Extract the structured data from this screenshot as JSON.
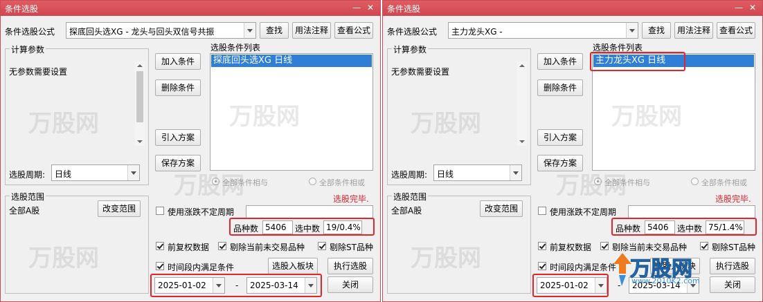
{
  "windows": [
    {
      "title": "条件选股",
      "formula_label": "条件选股公式",
      "formula_value": "探底回头选XG  -  龙头与回头双信号共振",
      "find_btn": "查找",
      "usage_btn": "用法注释",
      "view_btn": "查看公式",
      "params_group": "计算参数",
      "params_text": "无参数需要设置",
      "period_label": "选股周期:",
      "period_value": "日线",
      "cond_list_label": "选股条件列表",
      "cond_item": "探底回头选XG  日线",
      "add_btn": "加入条件",
      "del_btn": "删除条件",
      "import_btn": "引入方案",
      "save_btn": "保存方案",
      "radio_and": "全部条件相与",
      "radio_or": "全部条件相或",
      "status": "选股完毕.",
      "range_group": "选股范围",
      "range_value": "全部A股",
      "change_range_btn": "改变范围",
      "use_period_label": "使用涨跌不定周期",
      "count_label": "品种数",
      "count_value": "5406",
      "selected_label": "选中数",
      "selected_value": "19/0.4%",
      "prefix_label": "前复权数据",
      "exclude_untraded_label": "剔除当前未交易品种",
      "exclude_st_label": "剔除ST品种",
      "time_range_label": "时间段内满足条件",
      "to_block_btn": "选股入板块",
      "exec_btn": "执行选股",
      "date_from": "2025-01-02",
      "date_dash": "-",
      "date_to": "2025-03-14",
      "close_btn": "关闭"
    },
    {
      "title": "条件选股",
      "formula_label": "条件选股公式",
      "formula_value": "主力龙头XG  -",
      "find_btn": "查找",
      "usage_btn": "用法注释",
      "view_btn": "查看公式",
      "params_group": "计算参数",
      "params_text": "无参数需要设置",
      "period_label": "选股周期:",
      "period_value": "日线",
      "cond_list_label": "选股条件列表",
      "cond_item": "主力龙头XG  日线",
      "add_btn": "加入条件",
      "del_btn": "删除条件",
      "import_btn": "引入方案",
      "save_btn": "保存方案",
      "radio_and": "全部条件相与",
      "radio_or": "全部条件相或",
      "status": "选股完毕.",
      "range_group": "选股范围",
      "range_value": "全部A股",
      "change_range_btn": "改变范围",
      "use_period_label": "使用涨跌不定周期",
      "count_label": "品种数",
      "count_value": "5406",
      "selected_label": "选中数",
      "selected_value": "75/1.4%",
      "prefix_label": "前复权数据",
      "exclude_untraded_label": "剔除当前未交易品种",
      "exclude_st_label": "剔除ST品种",
      "time_range_label": "时间段内满足条件",
      "to_block_btn": "选股入板块",
      "exec_btn": "执行选股",
      "date_from": "2025-01-02",
      "date_dash": "-",
      "date_to": "2025-03-14",
      "close_btn": "关闭"
    }
  ],
  "watermark": {
    "text": "万股网",
    "logo_text": "万股网",
    "logo_url": "www.2010K2.com"
  },
  "colors": {
    "title_bar": "#d9534f",
    "selection": "#2f7fd6",
    "highlight": "#e3242b",
    "status": "#e0232c"
  }
}
